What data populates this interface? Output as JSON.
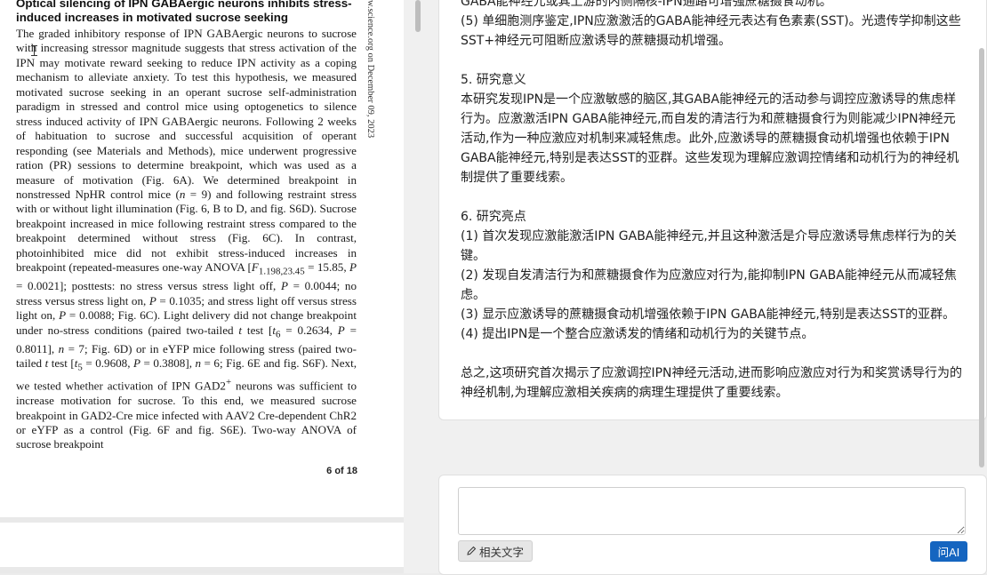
{
  "pdf": {
    "heading": "Optical silencing of IPN GABAergic neurons inhibits stress-induced increases in motivated sucrose seeking",
    "body_html": "The graded inhibitory response of IPN GABAergic neurons to sucrose with increasing stressor magnitude suggests that stress activation of the IPN may motivate reward seeking to reduce IPN activity as a coping mechanism to alleviate anxiety. To test this hypothesis, we measured motivated sucrose seeking in an operant sucrose self-administration paradigm in stressed and control mice using optogenetics to silence stress induced activity of IPN GABAergic neurons. Following 2 weeks of habituation to sucrose and successful acquisition of operant responding (see Materials and Methods), mice underwent progressive ration (PR) sessions to determine breakpoint, which was used as a measure of motivation (Fig. 6A). We determined breakpoint in nonstressed NpHR control mice (<i>n</i> = 9) and following restraint stress with or without light illumination (Fig. 6, B to D, and fig. S6D). Sucrose breakpoint increased in mice following restraint stress compared to the breakpoint determined without stress (Fig. 6C). In contrast, photoinhibited mice did not exhibit stress-induced increases in breakpoint (repeated-measures one-way ANOVA [<i>F</i><sub>1.198,23.45</sub> = 15.85, <i>P</i> = 0.0021]; posttests: no stress versus stress light off, <i>P</i> = 0.0044; no stress versus stress light on, <i>P</i> = 0.1035; and stress light off versus stress light on, <i>P</i> = 0.0088; Fig. 6C). Light delivery did not change breakpoint under no-stress conditions (paired two-tailed <i>t</i> test [<i>t</i><sub>6</sub> = 0.2634, <i>P</i> = 0.8011], <i>n</i> = 7; Fig. 6D) or in eYFP mice following stress (paired two-tailed <i>t</i> test [<i>t</i><sub>5</sub> = 0.9608, <i>P</i> = 0.3808], <i>n</i> = 6; Fig. 6E and fig. S6F). Next, we tested whether activation of IPN GAD2<sup>+</sup> neurons was sufficient to increase motivation for sucrose. To this end, we measured sucrose breakpoint in GAD2-Cre mice infected with AAV2 Cre-dependent ChR2 or eYFP as a control (Fig. 6F and fig. S6E). Two-way ANOVA of sucrose breakpoint",
    "page_number": "6 of 18",
    "side_watermark": "w.science.org on December 09, 2023"
  },
  "chat": {
    "answer_lines": [
      "GABA能神经元或其上游的内侧隔核-IPN通路可增强蔗糖摄食动机。",
      "(5) 单细胞测序鉴定,IPN应激激活的GABA能神经元表达有色素素(SST)。光遗传学抑制这些SST+神经元可阻断应激诱导的蔗糖摄动机增强。",
      "",
      "5. 研究意义",
      "本研究发现IPN是一个应激敏感的脑区,其GABA能神经元的活动参与调控应激诱导的焦虑样行为。应激激活IPN GABA能神经元,而自发的清洁行为和蔗糖摄食行为则能减少IPN神经元活动,作为一种应激应对机制来减轻焦虑。此外,应激诱导的蔗糖摄食动机增强也依赖于IPN GABA能神经元,特别是表达SST的亚群。这些发现为理解应激调控情绪和动机行为的神经机制提供了重要线索。",
      "",
      "6. 研究亮点",
      "(1) 首次发现应激能激活IPN GABA能神经元,并且这种激活是介导应激诱导焦虑样行为的关键。",
      "(2) 发现自发清洁行为和蔗糖摄食作为应激应对行为,能抑制IPN GABA能神经元从而减轻焦虑。",
      "(3) 显示应激诱导的蔗糖摄食动机增强依赖于IPN GABA能神经元,特别是表达SST的亚群。",
      "(4) 提出IPN是一个整合应激诱发的情绪和动机行为的关键节点。",
      "",
      "总之,这项研究首次揭示了应激调控IPN神经元活动,进而影响应激应对行为和奖赏诱导行为的神经机制,为理解应激相关疾病的病理生理提供了重要线索。"
    ],
    "input_value": "",
    "related_text_label": "相关文字",
    "ask_ai_label": "问AI"
  }
}
